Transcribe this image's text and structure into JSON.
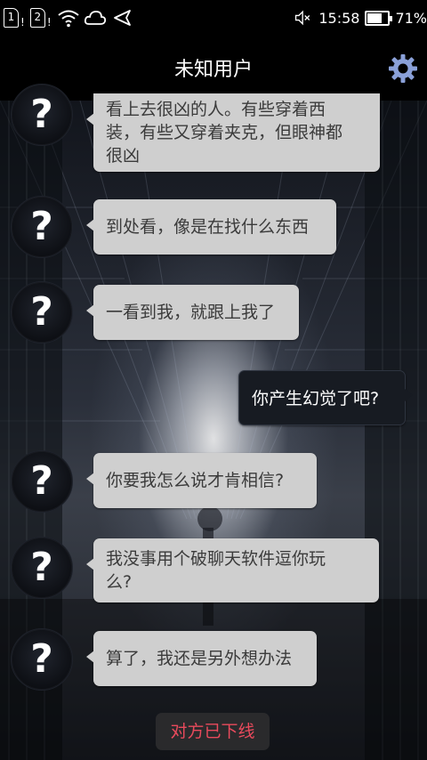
{
  "status_bar": {
    "sim1_label": "1",
    "sim2_label": "2",
    "sim_alert": "!",
    "time": "15:58",
    "battery_percent": "71%",
    "battery_level": 0.71,
    "icons": [
      "sim1-icon",
      "sim2-icon",
      "wifi-icon",
      "cloud-icon",
      "location-arrow-icon",
      "mute-icon",
      "battery-icon"
    ]
  },
  "header": {
    "title": "未知用户",
    "settings_icon": "gear-icon",
    "accent_color": "#8aa0d8"
  },
  "avatar_glyph": "?",
  "messages": [
    {
      "from": "other",
      "lines": [
        "看上去很凶的人。有些穿着西",
        "装，有些又穿着夹克，但眼神都",
        "很凶"
      ]
    },
    {
      "from": "other",
      "lines": [
        "到处看，像是在找什么东西"
      ]
    },
    {
      "from": "other",
      "lines": [
        "一看到我，就跟上我了"
      ]
    },
    {
      "from": "me",
      "lines": [
        "你产生幻觉了吧?"
      ]
    },
    {
      "from": "other",
      "lines": [
        "你要我怎么说才肯相信?"
      ]
    },
    {
      "from": "other",
      "lines": [
        "我没事用个破聊天软件逗你玩",
        "么?"
      ]
    },
    {
      "from": "other",
      "lines": [
        "算了，我还是另外想办法"
      ]
    }
  ],
  "footer": {
    "status_text": "对方已下线",
    "status_color": "#e94a5c"
  }
}
